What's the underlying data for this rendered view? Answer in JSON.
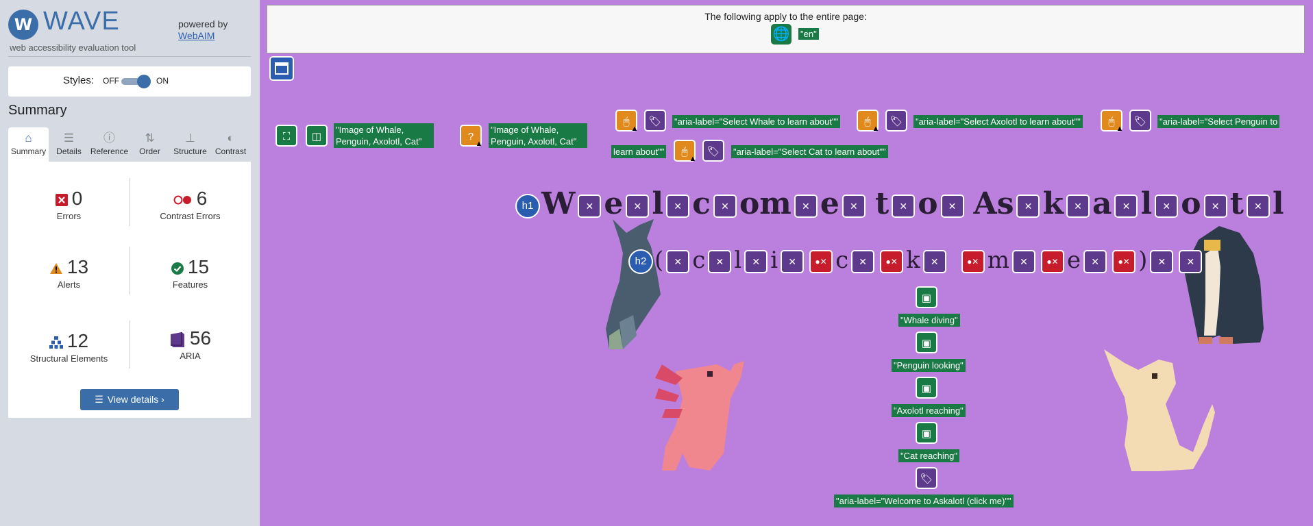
{
  "sidebar": {
    "logo_letter": "W",
    "logo_text": "WAVE",
    "logo_subtitle": "web accessibility evaluation tool",
    "powered_by": "powered by",
    "webaim_link": "WebAIM",
    "styles_label": "Styles:",
    "styles_off": "OFF",
    "styles_on": "ON",
    "summary_title": "Summary",
    "tabs": [
      {
        "label": "Summary",
        "icon": "home-icon"
      },
      {
        "label": "Details",
        "icon": "list-icon"
      },
      {
        "label": "Reference",
        "icon": "info-icon"
      },
      {
        "label": "Order",
        "icon": "order-icon"
      },
      {
        "label": "Structure",
        "icon": "structure-icon"
      },
      {
        "label": "Contrast",
        "icon": "contrast-icon"
      }
    ],
    "stats": {
      "errors": {
        "count": "0",
        "label": "Errors"
      },
      "contrast_errors": {
        "count": "6",
        "label": "Contrast Errors"
      },
      "alerts": {
        "count": "13",
        "label": "Alerts"
      },
      "features": {
        "count": "15",
        "label": "Features"
      },
      "structural": {
        "count": "12",
        "label": "Structural Elements"
      },
      "aria": {
        "count": "56",
        "label": "ARIA"
      }
    },
    "view_details": "View details ›"
  },
  "main": {
    "page_notice": "The following apply to the entire page:",
    "lang_label": "\"en\"",
    "image_label_1": "\"Image of Whale, Penguin, Axolotl, Cat\"",
    "image_label_2": "\"Image of Whale, Penguin, Axolotl, Cat\"",
    "aria_whale": "\"aria-label=\"Select Whale to learn about\"\"",
    "aria_axolotl": "\"aria-label=\"Select Axolotl to learn about\"\"",
    "aria_penguin_a": "\"aria-label=\"Select Penguin to",
    "aria_penguin_b": "learn about\"\"",
    "aria_cat": "\"aria-label=\"Select Cat to learn about\"\"",
    "h1_badge": "h1",
    "h2_badge": "h2",
    "h1_chars": [
      "W",
      "e",
      "l",
      "c",
      "o",
      "m",
      "e",
      "t",
      "o",
      "A",
      "s",
      "k",
      "a",
      "l",
      "o",
      "t",
      "l"
    ],
    "h2_chars": [
      "(",
      "c",
      "l",
      "i",
      "c",
      "k",
      "m",
      "e",
      ")"
    ],
    "alt_whale": "\"Whale diving\"",
    "alt_penguin": "\"Penguin looking\"",
    "alt_axolotl": "\"Axolotl reaching\"",
    "alt_cat": "\"Cat reaching\"",
    "aria_welcome": "\"aria-label=\"Welcome to Askalotl (click me)\"\""
  },
  "colors": {
    "feature_green": "#1a7a46",
    "aria_purple": "#5e3a8c",
    "alert_orange": "#e08a1e",
    "error_red": "#c71c2b",
    "structure_blue": "#2a5db0",
    "page_background": "#bb80dd"
  }
}
